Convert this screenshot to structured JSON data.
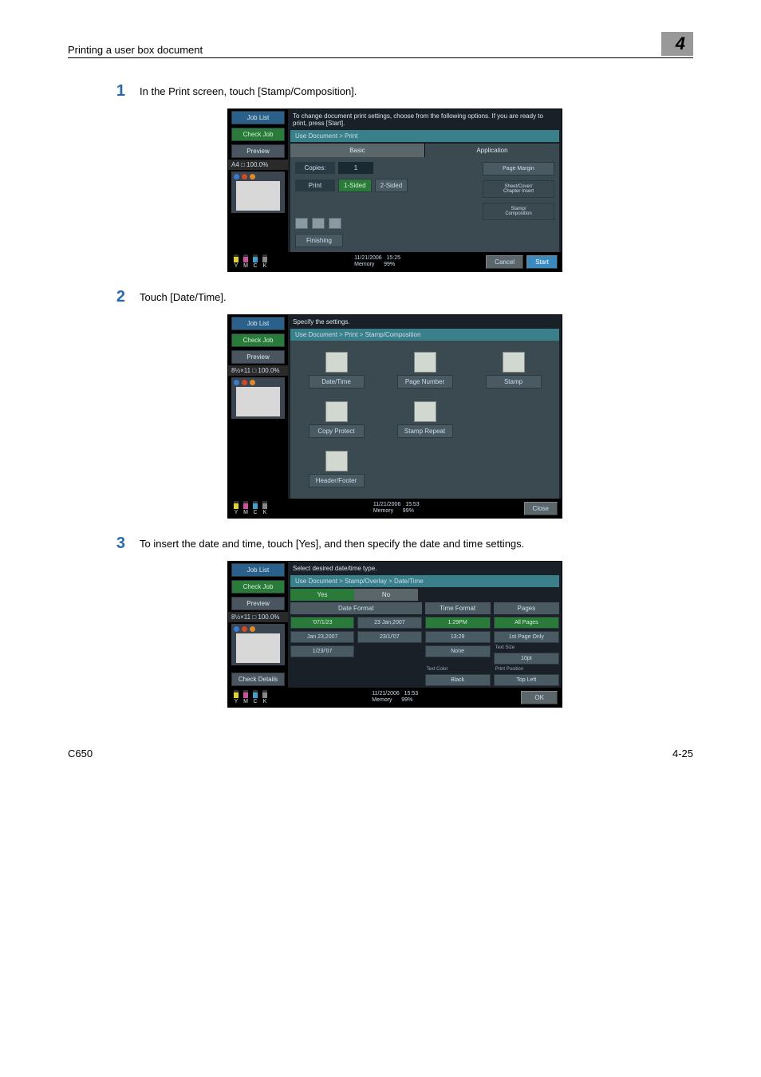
{
  "header": {
    "section": "Printing a user box document",
    "chapter": "4"
  },
  "footer": {
    "left": "C650",
    "right": "4-25"
  },
  "steps": {
    "s1": {
      "num": "1",
      "txt": "In the Print screen, touch [Stamp/Composition]."
    },
    "s2": {
      "num": "2",
      "txt": "Touch [Date/Time]."
    },
    "s3": {
      "num": "3",
      "txt": "To insert the date and time, touch [Yes], and then specify the date and time settings."
    }
  },
  "common": {
    "joblist": "Job List",
    "checkjob": "Check Job",
    "preview": "Preview",
    "checkdetails": "Check Details",
    "date": "11/21/2006",
    "time1": "15:25",
    "time2": "15:53",
    "mem": "Memory",
    "mempct": "99%",
    "cancel": "Cancel",
    "start": "Start",
    "close": "Close",
    "ok": "OK",
    "toner": {
      "y": "Y",
      "m": "M",
      "c": "C",
      "k": "K"
    },
    "thumb_a4": "A4",
    "thumb_full": "100.0%",
    "thumb_mix": "8½×11"
  },
  "shot1": {
    "top": "To change document print settings, choose from the following options. If you are ready to print, press [Start].",
    "crumb": "Use Document > Print",
    "tabs": {
      "basic": "Basic",
      "app": "Application"
    },
    "copies_lbl": "Copies:",
    "copies_val": "1",
    "print_lbl": "Print",
    "one": "1-Sided",
    "two": "2-Sided",
    "finishing": "Finishing",
    "app": {
      "margin": "Page Margin",
      "sheet": "Sheet/Cover/\nChapter Insert",
      "stamp": "Stamp/\nComposition"
    }
  },
  "shot2": {
    "top": "Specify the settings.",
    "crumb": "Use Document > Print > Stamp/Composition",
    "btns": {
      "dt": "Date/Time",
      "pn": "Page Number",
      "st": "Stamp",
      "cp": "Copy Protect",
      "sr": "Stamp Repeat",
      "hf": "Header/Footer"
    }
  },
  "shot3": {
    "top": "Select desired date/time type.",
    "crumb": "Use Document > Stamp/Overlay > Date/Time",
    "yes": "Yes",
    "no": "No",
    "hd": {
      "df": "Date Format",
      "tf": "Time Format",
      "pg": "Pages"
    },
    "df": {
      "a": "'07/1/23",
      "b": "23 Jan,2007",
      "c": "Jan 23,2007",
      "d": "23/1/'07",
      "e": "1/23/'07"
    },
    "tf": {
      "a": "1:29PM",
      "b": "13:29",
      "c": "None"
    },
    "pg": {
      "a": "All Pages",
      "b": "1st Page Only"
    },
    "ts": {
      "lbl": "Text Size",
      "val": "10pt"
    },
    "tc": {
      "lbl": "Text Color",
      "val": "Black"
    },
    "pp": {
      "lbl": "Print Position",
      "val": "Top Left"
    }
  }
}
